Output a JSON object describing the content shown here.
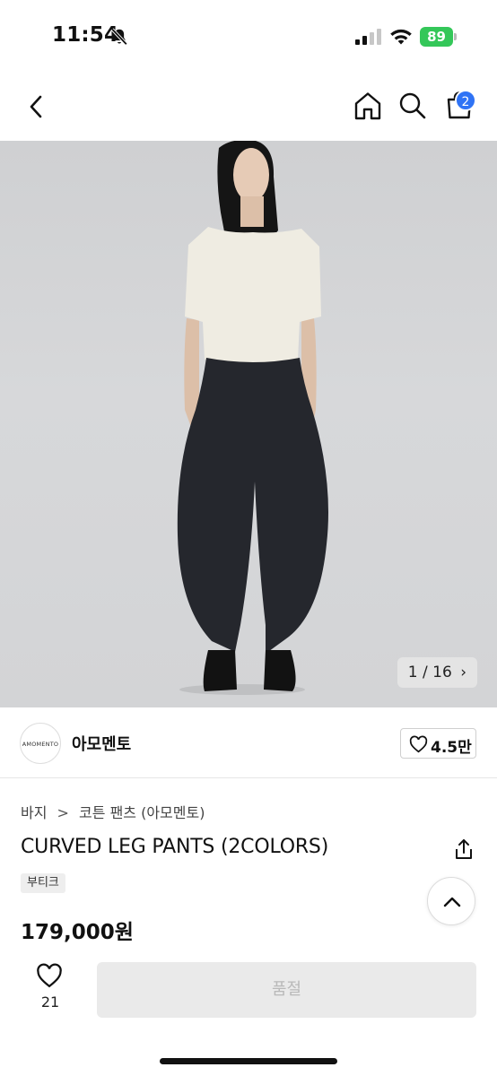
{
  "status_bar": {
    "time": "11:54",
    "battery": "89",
    "icons": [
      "bell-off-icon",
      "signal-icon",
      "wifi-icon",
      "battery-icon"
    ],
    "battery_color": "#34c759"
  },
  "nav": {
    "icons": [
      "back-chevron-icon",
      "home-icon",
      "search-icon",
      "cart-icon"
    ],
    "cart_count": "2",
    "badge_color": "#2f73f5"
  },
  "gallery": {
    "counter": "1 / 16",
    "counter_arrow": "›"
  },
  "seller": {
    "logo_text": "AMOMENTO",
    "name": "아모멘토",
    "likes": "4.5만"
  },
  "product": {
    "breadcrumb": [
      "바지",
      "코튼 팬츠 (아모멘토)"
    ],
    "breadcrumb_separator": ">",
    "title": "CURVED LEG PANTS (2COLORS)",
    "tag": "부티크",
    "price": "179,000원"
  },
  "footer": {
    "like_count": "21",
    "buy_label": "품절"
  }
}
